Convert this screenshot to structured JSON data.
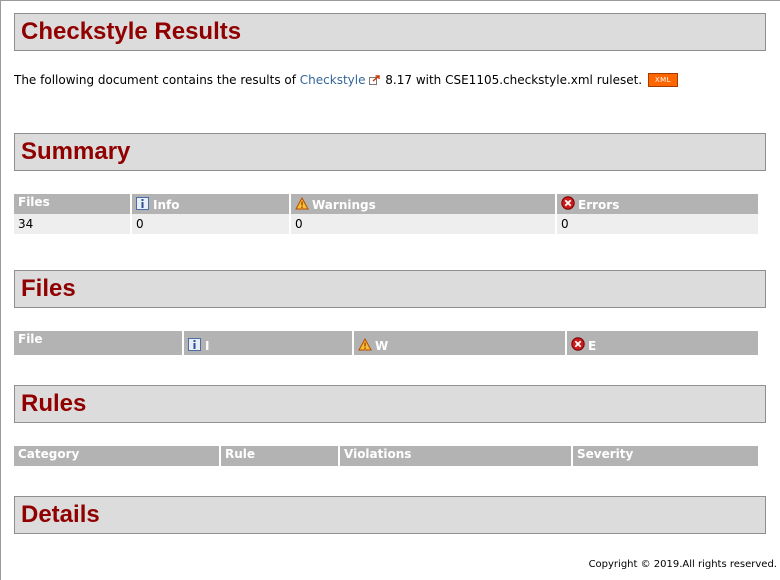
{
  "title": "Checkstyle Results",
  "intro": {
    "prefix": "The following document contains the results of ",
    "link_label": "Checkstyle",
    "suffix": " 8.17 with CSE1105.checkstyle.xml ruleset.",
    "xml_badge": "XML"
  },
  "summary": {
    "heading": "Summary",
    "headers": {
      "files": "Files",
      "info": "Info",
      "warnings": "Warnings",
      "errors": "Errors"
    },
    "row": {
      "files": "34",
      "info": "0",
      "warnings": "0",
      "errors": "0"
    }
  },
  "files": {
    "heading": "Files",
    "headers": {
      "file": "File",
      "i": "I",
      "w": "W",
      "e": "E"
    }
  },
  "rules": {
    "heading": "Rules",
    "headers": {
      "category": "Category",
      "rule": "Rule",
      "violations": "Violations",
      "severity": "Severity"
    }
  },
  "details": {
    "heading": "Details"
  },
  "footer": "Copyright © 2019.All rights reserved.",
  "colors": {
    "heading": "#900000",
    "header_bg": "#b3b3b3",
    "link": "#336699",
    "xml_badge": "#ff6600"
  },
  "icons": {
    "info": "info-icon",
    "warning": "warning-icon",
    "error": "error-icon",
    "external": "external-link-icon"
  }
}
